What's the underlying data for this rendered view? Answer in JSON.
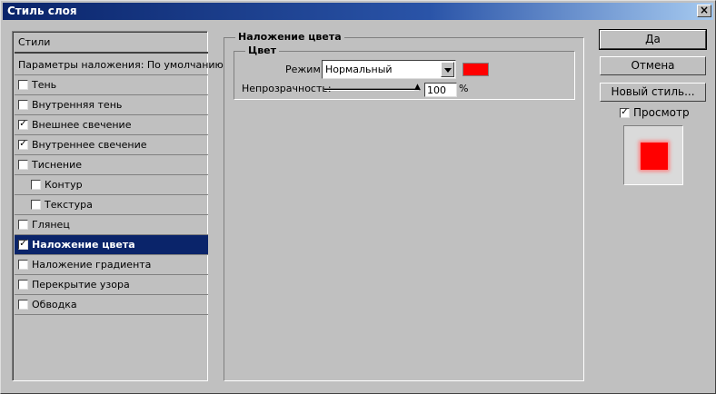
{
  "window": {
    "title": "Стиль слоя",
    "close_label": "×"
  },
  "left_panel": {
    "styles_label": "Стили",
    "blending_label": "Параметры наложения: По умолчанию",
    "items": [
      {
        "label": "Тень",
        "checked": false,
        "indent": false,
        "selected": false
      },
      {
        "label": "Внутренняя тень",
        "checked": false,
        "indent": false,
        "selected": false
      },
      {
        "label": "Внешнее свечение",
        "checked": true,
        "indent": false,
        "selected": false
      },
      {
        "label": "Внутреннее свечение",
        "checked": true,
        "indent": false,
        "selected": false
      },
      {
        "label": "Тиснение",
        "checked": false,
        "indent": false,
        "selected": false
      },
      {
        "label": "Контур",
        "checked": false,
        "indent": true,
        "selected": false
      },
      {
        "label": "Текстура",
        "checked": false,
        "indent": true,
        "selected": false
      },
      {
        "label": "Глянец",
        "checked": false,
        "indent": false,
        "selected": false
      },
      {
        "label": "Наложение цвета",
        "checked": true,
        "indent": false,
        "selected": true
      },
      {
        "label": "Наложение градиента",
        "checked": false,
        "indent": false,
        "selected": false
      },
      {
        "label": "Перекрытие узора",
        "checked": false,
        "indent": false,
        "selected": false
      },
      {
        "label": "Обводка",
        "checked": false,
        "indent": false,
        "selected": false
      }
    ]
  },
  "main": {
    "group_title": "Наложение цвета",
    "color_group_title": "Цвет",
    "mode_label": "Режим:",
    "mode_value": "Нормальный",
    "color_swatch": "#ff0000",
    "opacity_label": "Непрозрачность:",
    "opacity_value": "100",
    "opacity_unit": "%",
    "opacity_level": 1.0
  },
  "buttons": {
    "ok": "Да",
    "cancel": "Отмена",
    "new_style": "Новый стиль..."
  },
  "preview": {
    "label": "Просмотр",
    "checked": true,
    "color": "#ff0000"
  }
}
